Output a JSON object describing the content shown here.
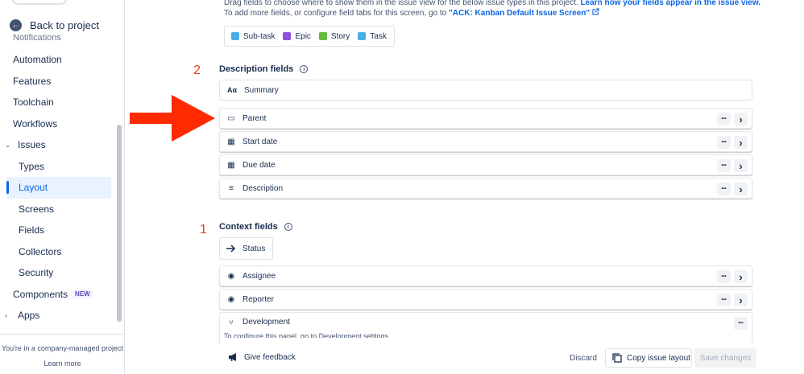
{
  "sidebar": {
    "back_label": "Back to project",
    "faded_item": "Notifications",
    "items": [
      {
        "label": "Automation",
        "kind": "item"
      },
      {
        "label": "Features",
        "kind": "item"
      },
      {
        "label": "Toolchain",
        "kind": "item"
      },
      {
        "label": "Workflows",
        "kind": "item"
      },
      {
        "label": "Issues",
        "kind": "group"
      },
      {
        "label": "Types",
        "kind": "sub"
      },
      {
        "label": "Layout",
        "kind": "sub-active"
      },
      {
        "label": "Screens",
        "kind": "sub"
      },
      {
        "label": "Fields",
        "kind": "sub"
      },
      {
        "label": "Collectors",
        "kind": "sub"
      },
      {
        "label": "Security",
        "kind": "sub"
      },
      {
        "label": "Components",
        "kind": "item",
        "badge": "NEW"
      },
      {
        "label": "Apps",
        "kind": "group-collapsed"
      }
    ],
    "footer_text": "You're in a company-managed project",
    "footer_link": "Learn more"
  },
  "intro": {
    "line1_text": "Drag fields to choose where to show them in the issue view for the below issue types in this project. ",
    "line1_link": "Learn how your fields appear in the issue view.",
    "line2_text": "To add more fields, or configure field tabs for this screen, go to ",
    "line2_link": "\"ACK: Kanban Default Issue Screen\""
  },
  "issue_types": [
    {
      "label": "Sub-task",
      "color": "#4bade8"
    },
    {
      "label": "Epic",
      "color": "#904ee2"
    },
    {
      "label": "Story",
      "color": "#63ba3c"
    },
    {
      "label": "Task",
      "color": "#4bade8"
    }
  ],
  "description_section": {
    "title": "Description fields",
    "annotation": "2",
    "fields": [
      {
        "label": "Summary",
        "icon": "text-format-icon",
        "glyph": "Aα"
      },
      {
        "label": "Parent",
        "icon": "parent-icon",
        "glyph": "▭"
      },
      {
        "label": "Start date",
        "icon": "calendar-icon",
        "glyph": "▦"
      },
      {
        "label": "Due date",
        "icon": "calendar-icon",
        "glyph": "▦"
      },
      {
        "label": "Description",
        "icon": "align-left-icon",
        "glyph": "≡"
      }
    ]
  },
  "context_section": {
    "title": "Context fields",
    "annotation": "1",
    "status_label": "Status",
    "fields": [
      {
        "label": "Assignee",
        "icon": "person-icon",
        "glyph": "◉"
      },
      {
        "label": "Reporter",
        "icon": "person-icon",
        "glyph": "◉"
      },
      {
        "label": "Development",
        "icon": "branch-icon",
        "glyph": "⑂"
      }
    ],
    "dev_hint": "To configure this panel, go to Development settings"
  },
  "actions": {
    "more_glyph": "•••",
    "expand_glyph": "›"
  },
  "footer": {
    "feedback_label": "Give feedback",
    "discard_label": "Discard",
    "copy_label": "Copy issue layout",
    "save_label": "Save changes"
  },
  "colors": {
    "accent": "#0c66e4",
    "annotation_red": "#ff2a00"
  }
}
